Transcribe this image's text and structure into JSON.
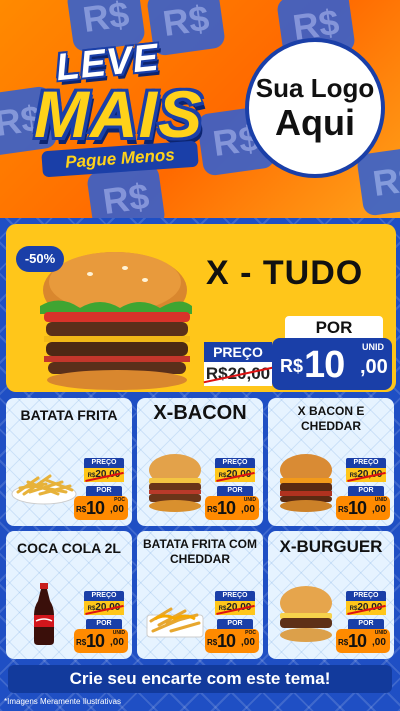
{
  "header": {
    "logo": {
      "top": "LEVE",
      "main": "MAIS",
      "sub": "Pague Menos"
    },
    "brand_placeholder": {
      "line1": "Sua Logo",
      "line2": "Aqui"
    },
    "bg_tile_text": "R$"
  },
  "featured": {
    "discount": "-50%",
    "name": "X - TUDO",
    "old_label": "PREÇO",
    "old_price": "R$20,00",
    "new_label": "POR",
    "currency": "R$",
    "price_int": "10",
    "price_cents": ",00",
    "unit": "UNID"
  },
  "products": [
    {
      "name": "BATATA FRITA",
      "old_label": "PREÇO",
      "old_rs": "R$",
      "old_price": "20,00",
      "new_label": "POR",
      "currency": "R$",
      "price_int": "10",
      "price_cents": ",00",
      "unit": "POC"
    },
    {
      "name": "X-BACON",
      "old_label": "PREÇO",
      "old_rs": "R$",
      "old_price": "20,00",
      "new_label": "POR",
      "currency": "R$",
      "price_int": "10",
      "price_cents": ",00",
      "unit": "UNID"
    },
    {
      "name": "X BACON E CHEDDAR",
      "old_label": "PREÇO",
      "old_rs": "R$",
      "old_price": "20,00",
      "new_label": "POR",
      "currency": "R$",
      "price_int": "10",
      "price_cents": ",00",
      "unit": "UNID"
    },
    {
      "name": "COCA COLA 2L",
      "old_label": "PREÇO",
      "old_rs": "R$",
      "old_price": "20,00",
      "new_label": "POR",
      "currency": "R$",
      "price_int": "10",
      "price_cents": ",00",
      "unit": "UNID"
    },
    {
      "name": "BATATA FRITA COM CHEDDAR",
      "old_label": "PREÇO",
      "old_rs": "R$",
      "old_price": "20,00",
      "new_label": "POR",
      "currency": "R$",
      "price_int": "10",
      "price_cents": ",00",
      "unit": "POC"
    },
    {
      "name": "X-BURGUER",
      "old_label": "PREÇO",
      "old_rs": "R$",
      "old_price": "20,00",
      "new_label": "POR",
      "currency": "R$",
      "price_int": "10",
      "price_cents": ",00",
      "unit": "UNID"
    }
  ],
  "footer": {
    "cta": "Crie seu encarte com este tema!",
    "disclaimer": "*Imagens Meramente Ilustrativas"
  },
  "colors": {
    "primary_blue": "#1a3fa8",
    "accent_yellow": "#ffc61a",
    "accent_orange": "#ff8a00",
    "card_bg": "#e6f3ff"
  },
  "icons": {
    "featured": "burger-icon",
    "products": [
      "fries-icon",
      "burger-icon",
      "burger-icon",
      "soda-bottle-icon",
      "fries-cheddar-icon",
      "burger-icon"
    ]
  }
}
